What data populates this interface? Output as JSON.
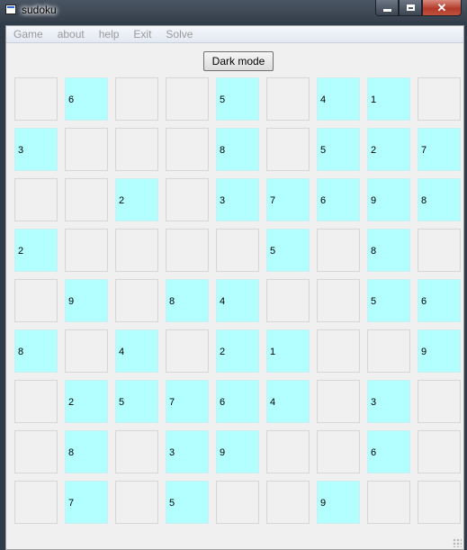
{
  "window": {
    "title": "sudoku",
    "icon": "app-window-icon",
    "controls": [
      "minimize-icon",
      "maximize-icon",
      "close-icon"
    ]
  },
  "menu": [
    "Game",
    "about",
    "help",
    "Exit",
    "Solve"
  ],
  "toolbar": {
    "dark_mode_label": "Dark mode"
  },
  "colors": {
    "given_cell": "#b3ffff",
    "empty_cell": "#f0f0f0",
    "menu_text": "#9a9a9a"
  },
  "board": [
    [
      "",
      "6",
      "",
      "",
      "5",
      "",
      "4",
      "1",
      ""
    ],
    [
      "3",
      "",
      "",
      "",
      "8",
      "",
      "5",
      "2",
      "7"
    ],
    [
      "",
      "",
      "2",
      "",
      "3",
      "7",
      "6",
      "9",
      "8"
    ],
    [
      "2",
      "",
      "",
      "",
      "",
      "5",
      "",
      "8",
      ""
    ],
    [
      "",
      "9",
      "",
      "8",
      "4",
      "",
      "",
      "5",
      "6"
    ],
    [
      "8",
      "",
      "4",
      "",
      "2",
      "1",
      "",
      "",
      "9"
    ],
    [
      "",
      "2",
      "5",
      "7",
      "6",
      "4",
      "",
      "3",
      ""
    ],
    [
      "",
      "8",
      "",
      "3",
      "9",
      "",
      "",
      "6",
      ""
    ],
    [
      "",
      "7",
      "",
      "5",
      "",
      "",
      "9",
      "",
      ""
    ]
  ]
}
